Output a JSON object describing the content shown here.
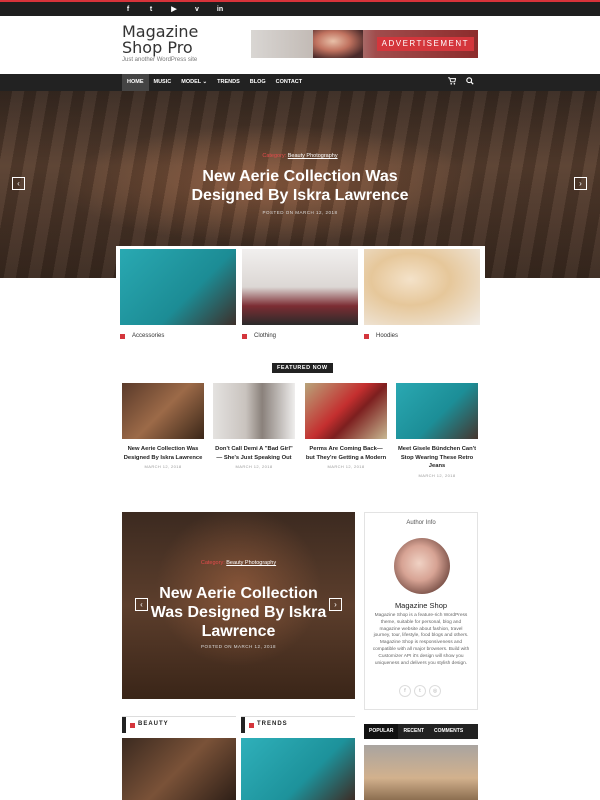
{
  "topbar": {
    "social": [
      "f",
      "t",
      "▶",
      "v",
      "in"
    ]
  },
  "header": {
    "site_title": "Magazine Shop Pro",
    "tagline": "Just another WordPress site",
    "ad_label": "ADVERTISEMENT"
  },
  "nav": {
    "items": [
      "HOME",
      "MUSIC",
      "MODEL ⌄",
      "TRENDS",
      "BLOG",
      "CONTACT"
    ],
    "cart_icon": "cart-icon",
    "search_icon": "search-icon"
  },
  "hero": {
    "category_key": "Category:",
    "category_value": "Beauty Photography",
    "title": "New Aerie Collection Was Designed By Iskra Lawrence",
    "date": "POSTED ON MARCH 12, 2018"
  },
  "categories": [
    {
      "label": "Accessories",
      "color": "#1f9aa3"
    },
    {
      "label": "Clothing",
      "color": "#e9e6e4"
    },
    {
      "label": "Hoodies",
      "color": "#ead9c9"
    }
  ],
  "featured": {
    "tag": "FEATURED NOW",
    "posts": [
      {
        "title": "New Aerie Collection Was Designed By Iskra Lawrence",
        "date": "MARCH 12, 2018"
      },
      {
        "title": "Don't Call Demi A \"Bad Girl\" — She's Just Speaking Out",
        "date": "MARCH 12, 2018"
      },
      {
        "title": "Perms Are Coming Back— but They're Getting a Modern",
        "date": "MARCH 12, 2018"
      },
      {
        "title": "Meet Gisele Bündchen Can't Stop Wearing These Retro Jeans",
        "date": "MARCH 12, 2018"
      }
    ]
  },
  "big_slider": {
    "category_key": "Category:",
    "category_value": "Beauty Photography",
    "title": "New Aerie Collection Was Designed By Iskra Lawrence",
    "date": "POSTED ON MARCH 12, 2018"
  },
  "author": {
    "heading": "Author Info",
    "name": "Magazine Shop",
    "bio": "Magazine Shop is a feature-rich WordPress theme, suitable for personal, blog and magazine website about fashion, travel journey, tour, lifestyle, food blogs and others. Magazine Shop is responsiveness and compatible with all major browsers. Build with Customizer API it's design will show you uniqueness and delivers you stylish design.",
    "social": [
      "f",
      "t",
      "◎"
    ]
  },
  "sections": {
    "beauty": "BEAUTY",
    "trends": "TRENDS"
  },
  "tabs": [
    "POPULAR",
    "RECENT",
    "COMMENTS"
  ],
  "colors": {
    "accent": "#d4363c",
    "dark": "#222222"
  }
}
